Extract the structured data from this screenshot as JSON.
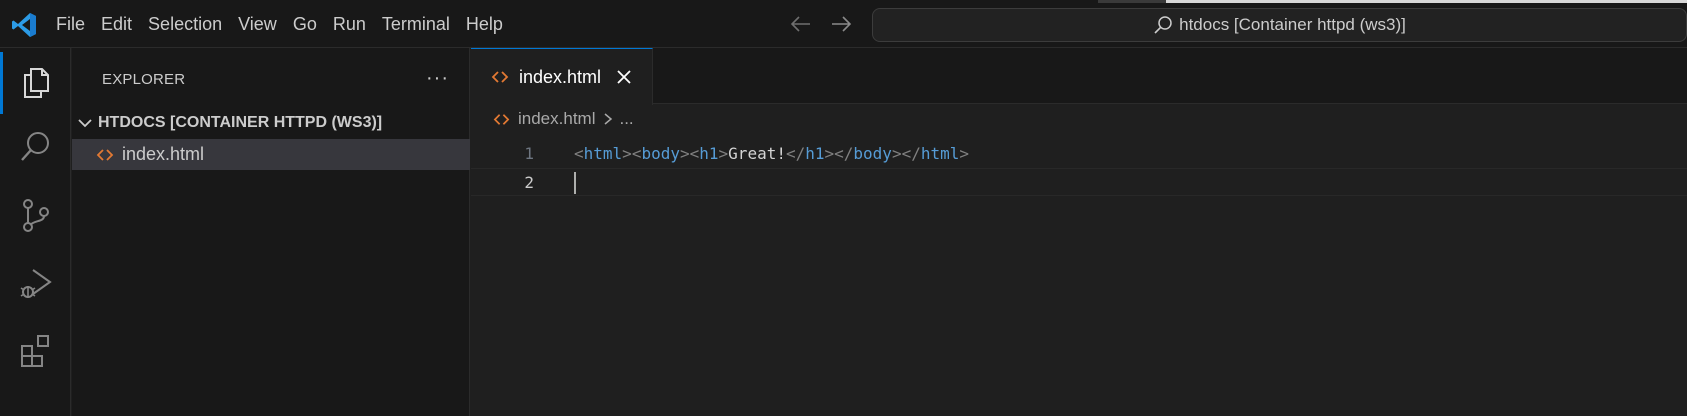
{
  "menu": [
    "File",
    "Edit",
    "Selection",
    "View",
    "Go",
    "Run",
    "Terminal",
    "Help"
  ],
  "command_center": {
    "label": "htdocs [Container httpd (ws3)]",
    "icon": "search-icon"
  },
  "activity_bar": {
    "items": [
      {
        "name": "explorer",
        "icon": "files-icon",
        "active": true
      },
      {
        "name": "search",
        "icon": "search-icon"
      },
      {
        "name": "source-control",
        "icon": "source-control-icon"
      },
      {
        "name": "run-and-debug",
        "icon": "run-debug-icon"
      },
      {
        "name": "extensions",
        "icon": "extensions-icon"
      }
    ]
  },
  "sidebar": {
    "title": "EXPLORER",
    "more": "···",
    "folder": "HTDOCS [CONTAINER HTTPD (WS3)]",
    "files": [
      {
        "name": "index.html",
        "icon": "html-file-icon",
        "selected": true
      }
    ]
  },
  "editor": {
    "tab": {
      "label": "index.html",
      "icon": "html-file-icon",
      "close_icon": "close-icon"
    },
    "breadcrumb": {
      "file": "index.html",
      "more": "..."
    },
    "lines": [
      {
        "number": "1",
        "tokens": [
          {
            "t": "<",
            "c": "punct"
          },
          {
            "t": "html",
            "c": "tag"
          },
          {
            "t": ">",
            "c": "punct"
          },
          {
            "t": "<",
            "c": "punct"
          },
          {
            "t": "body",
            "c": "tag"
          },
          {
            "t": ">",
            "c": "punct"
          },
          {
            "t": "<",
            "c": "punct"
          },
          {
            "t": "h1",
            "c": "tag"
          },
          {
            "t": ">",
            "c": "punct"
          },
          {
            "t": "Great!",
            "c": "text"
          },
          {
            "t": "</",
            "c": "punct"
          },
          {
            "t": "h1",
            "c": "tag"
          },
          {
            "t": ">",
            "c": "punct"
          },
          {
            "t": "</",
            "c": "punct"
          },
          {
            "t": "body",
            "c": "tag"
          },
          {
            "t": ">",
            "c": "punct"
          },
          {
            "t": "</",
            "c": "punct"
          },
          {
            "t": "html",
            "c": "tag"
          },
          {
            "t": ">",
            "c": "punct"
          }
        ]
      },
      {
        "number": "2",
        "tokens": [],
        "current": true
      }
    ]
  },
  "colors": {
    "accent": "#0078d4",
    "html_icon": "#e37933",
    "tag": "#569cd6",
    "punctuation": "#808080"
  }
}
